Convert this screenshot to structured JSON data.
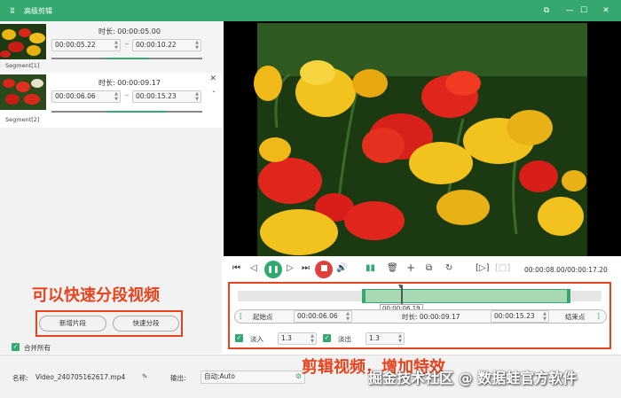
{
  "window": {
    "title": "高级剪辑",
    "logo_glyph": "ʬ"
  },
  "window_controls": {
    "restore": "⧉",
    "minimize": "—",
    "maximize": "☐",
    "close": "✕"
  },
  "segments": [
    {
      "duration_label": "时长: 00:00:05.00",
      "start": "00:00:05.22",
      "end": "00:00:10.22",
      "label": "Segment[1]"
    },
    {
      "duration_label": "时长: 00:00:09.17",
      "start": "00:00:06.06",
      "end": "00:00:15.23",
      "label": "Segment[2]"
    }
  ],
  "annotations": {
    "left_hint": "可以快速分段视频",
    "bottom_hint": "剪辑视频，增加特效"
  },
  "left_buttons": {
    "new_segment": "新增片段",
    "quick_split": "快速分段"
  },
  "merge_all": "合并所有",
  "playback": {
    "time_display": "00:00:08.00/00:00:17.20",
    "icons": [
      "skip-start-icon",
      "prev-frame-icon",
      "pause-icon",
      "next-frame-icon",
      "skip-end-icon",
      "stop-icon",
      "volume-icon",
      "split-icon",
      "delete-icon",
      "add-icon",
      "copy-icon",
      "refresh-icon",
      "mark-in-icon",
      "mark-out-icon"
    ]
  },
  "timeline": {
    "cursor_time": "00:00:06.19",
    "start_button": "起始点",
    "start_value": "00:00:06.06",
    "duration_label": "时长: 00:00:09.17",
    "end_value": "00:00:15.23",
    "end_button": "结束点",
    "fade_in_label": "淡入",
    "fade_in_value": "1.3",
    "fade_out_label": "淡出",
    "fade_out_value": "1.3"
  },
  "footer": {
    "name_label": "名称:",
    "file_name": "Video_240705162617.mp4",
    "output_label": "输出:",
    "output_value": "自动;Auto"
  },
  "watermark": "掘金技术社区 @ 数据蛙官方软件",
  "colors": {
    "accent": "#35a870",
    "annotation": "#e8431d"
  }
}
